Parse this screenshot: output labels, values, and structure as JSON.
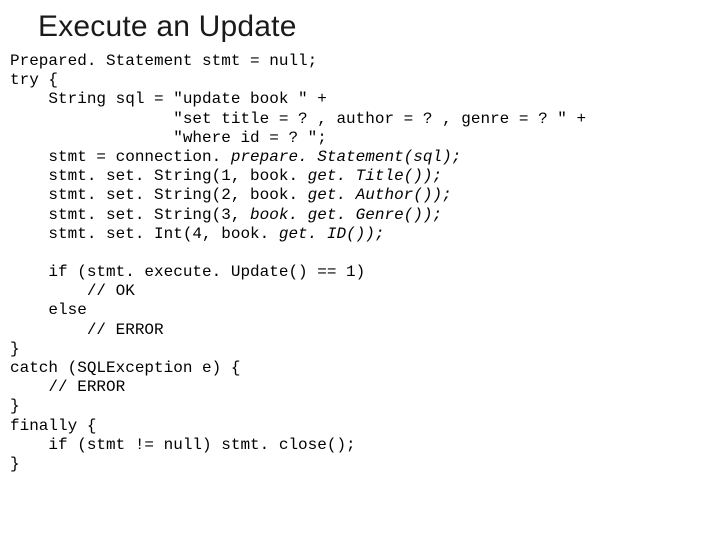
{
  "title": "Execute an Update",
  "code": {
    "l01": "Prepared. Statement stmt = null;",
    "l02": "try {",
    "l03": "    String sql = \"update book \" +",
    "l04": "                 \"set title = ? , author = ? , genre = ? \" +",
    "l05": "                 \"where id = ? \";",
    "l06a": "    stmt = connection.",
    "l06b": " prepare. Statement(sql);",
    "l07a": "    stmt. set. String(1, book.",
    "l07b": " get. Title());",
    "l08a": "    stmt. set. String(2, book.",
    "l08b": " get. Author());",
    "l09a": "    stmt. set. String(3, ",
    "l09b": "book. get. Genre());",
    "l10a": "    stmt. set. Int(4, book.",
    "l10b": " get. ID());",
    "l11": "",
    "l12": "    if (stmt. execute. Update() == 1)",
    "l13": "        // OK",
    "l14": "    else",
    "l15": "        // ERROR",
    "l16": "}",
    "l17": "catch (SQLException e) {",
    "l18": "    // ERROR",
    "l19": "}",
    "l20": "finally {",
    "l21": "    if (stmt != null) stmt. close();",
    "l22": "}"
  }
}
